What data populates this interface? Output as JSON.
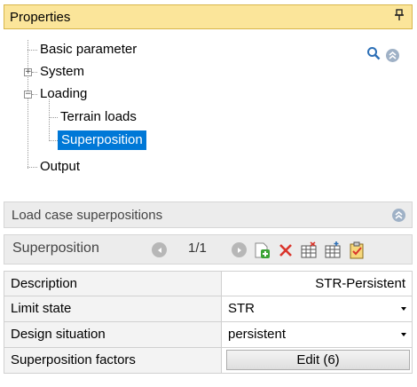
{
  "properties_panel": {
    "title": "Properties",
    "pin_glyph": "⊥",
    "tree": [
      {
        "label": "Basic parameter"
      },
      {
        "label": "System",
        "expander": "+"
      },
      {
        "label": "Loading",
        "expander": "−"
      },
      {
        "label": "Terrain loads"
      },
      {
        "label": "Superposition",
        "selected": true
      },
      {
        "label": "Output"
      }
    ],
    "icons": [
      "search-icon",
      "collapse-up-icon"
    ]
  },
  "load_case_panel": {
    "title": "Load case superpositions",
    "toolbar": {
      "label": "Superposition",
      "page": "1/1",
      "tools": [
        "add-icon",
        "delete-icon",
        "table-delete-icon",
        "table-insert-icon",
        "clipboard-check-icon"
      ]
    },
    "properties": [
      {
        "label": "Description",
        "value": "STR-Persistent"
      },
      {
        "label": "Limit state",
        "value": "STR"
      },
      {
        "label": "Design situation",
        "value": "persistent"
      },
      {
        "label": "Superposition factors",
        "value": "Edit (6)"
      }
    ]
  },
  "colors": {
    "header_yellow": "#fbe59a",
    "selection_blue": "#0078d7",
    "panel_gray": "#ececec",
    "delete_red": "#d9342b",
    "add_green": "#3aa335"
  }
}
